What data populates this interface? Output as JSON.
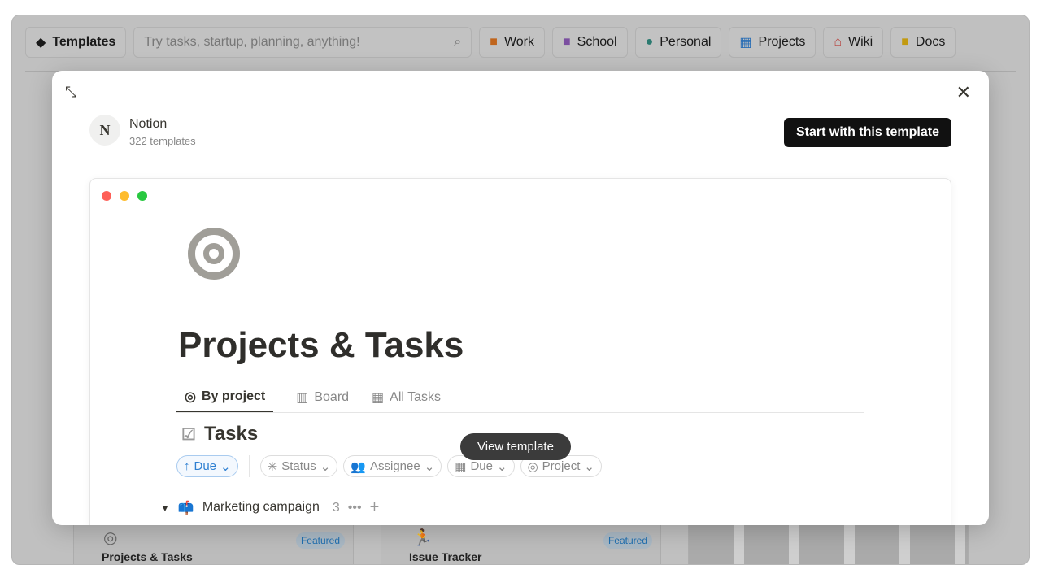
{
  "topbar": {
    "templates": "Templates",
    "search_placeholder": "Try tasks, startup, planning, anything!",
    "categories": [
      {
        "label": "Work",
        "color": "#d9730d"
      },
      {
        "label": "School",
        "color": "#9065b0"
      },
      {
        "label": "Personal",
        "color": "#2b8a7e"
      },
      {
        "label": "Projects",
        "color": "#2e7fd1"
      },
      {
        "label": "Wiki",
        "color": "#d44c47"
      },
      {
        "label": "Docs",
        "color": "#dfab01"
      }
    ]
  },
  "modal": {
    "creator": "Notion",
    "count": "322 templates",
    "start": "Start with this template",
    "preview": {
      "title": "Projects & Tasks",
      "tabs": [
        "By project",
        "Board",
        "All Tasks"
      ],
      "section": "Tasks",
      "filters": [
        "Due",
        "Status",
        "Assignee",
        "Due",
        "Project"
      ],
      "group": "Marketing campaign",
      "group_count": "3"
    },
    "tooltip": "View template"
  },
  "cards": [
    {
      "title": "Projects & Tasks",
      "badge": "Featured"
    },
    {
      "title": "Issue Tracker",
      "badge": "Featured"
    }
  ]
}
